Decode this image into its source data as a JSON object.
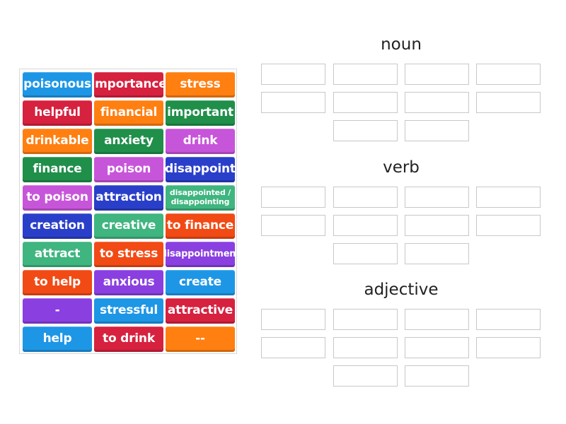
{
  "tiles": [
    {
      "label": "poisonous",
      "color": "#1e96e6"
    },
    {
      "label": "importance",
      "color": "#d6213f"
    },
    {
      "label": "stress",
      "color": "#ff7f11"
    },
    {
      "label": "helpful",
      "color": "#d6213f"
    },
    {
      "label": "financial",
      "color": "#ff7f11"
    },
    {
      "label": "important",
      "color": "#1f8f4a"
    },
    {
      "label": "drinkable",
      "color": "#ff7f11"
    },
    {
      "label": "anxiety",
      "color": "#1f8f4a"
    },
    {
      "label": "drink",
      "color": "#c755d9"
    },
    {
      "label": "finance",
      "color": "#1f8f4a"
    },
    {
      "label": "poison",
      "color": "#c755d9"
    },
    {
      "label": "disappoint",
      "color": "#2a3fc9"
    },
    {
      "label": "to poison",
      "color": "#c755d9"
    },
    {
      "label": "attraction",
      "color": "#2a3fc9"
    },
    {
      "label": "disappointed / disappointing",
      "color": "#3fb57f"
    },
    {
      "label": "creation",
      "color": "#2a3fc9"
    },
    {
      "label": "creative",
      "color": "#3fb57f"
    },
    {
      "label": "to finance",
      "color": "#f24a14"
    },
    {
      "label": "attract",
      "color": "#3fb57f"
    },
    {
      "label": "to stress",
      "color": "#f24a14"
    },
    {
      "label": "disappointment",
      "color": "#8a3fe0"
    },
    {
      "label": "to help",
      "color": "#f24a14"
    },
    {
      "label": "anxious",
      "color": "#8a3fe0"
    },
    {
      "label": "create",
      "color": "#1e96e6"
    },
    {
      "label": "-",
      "color": "#8a3fe0"
    },
    {
      "label": "stressful",
      "color": "#1e96e6"
    },
    {
      "label": "attractive",
      "color": "#d6213f"
    },
    {
      "label": "help",
      "color": "#1e96e6"
    },
    {
      "label": "to drink",
      "color": "#d6213f"
    },
    {
      "label": "--",
      "color": "#ff7f11"
    }
  ],
  "groups": [
    {
      "title": "noun",
      "slots": 10
    },
    {
      "title": "verb",
      "slots": 10
    },
    {
      "title": "adjective",
      "slots": 10
    }
  ]
}
